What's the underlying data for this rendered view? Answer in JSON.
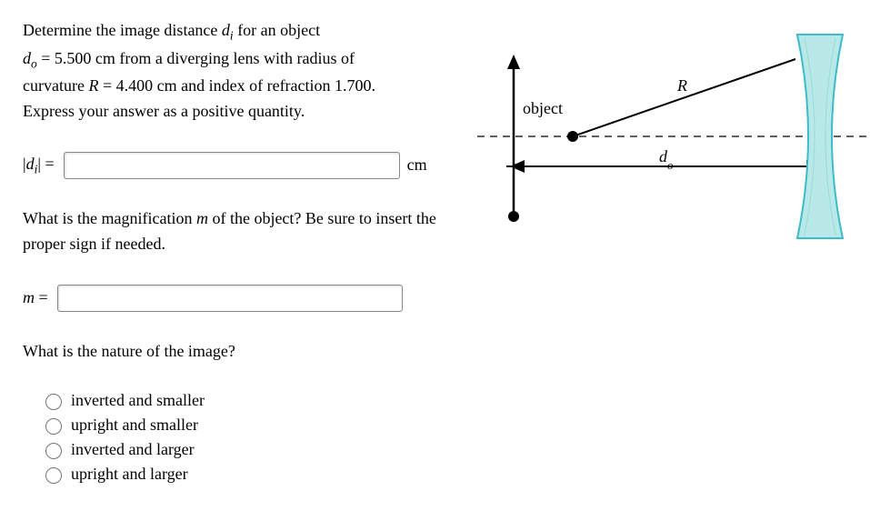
{
  "q1": {
    "prompt_parts": {
      "l1a": "Determine the image distance ",
      "l1b": "d",
      "l1c": "i",
      "l1d": " for an object",
      "l2a": "d",
      "l2b": "o",
      "l2c": " = 5.500 cm from a diverging lens with radius of",
      "l3a": "curvature ",
      "l3b": "R",
      "l3c": " = 4.400 cm and index of refraction 1.700.",
      "l4": "Express your answer as a positive quantity."
    },
    "label_a": "|",
    "label_b": "d",
    "label_c": "i",
    "label_d": "| =",
    "value": "",
    "unit": "cm"
  },
  "q2": {
    "prompt_a": "What is the magnification ",
    "prompt_b": "m",
    "prompt_c": " of the object? Be sure to insert the proper sign if needed.",
    "label_a": "m",
    "label_b": " =",
    "value": ""
  },
  "q3": {
    "prompt": "What is the nature of the image?",
    "options": [
      "inverted and smaller",
      "upright and smaller",
      "inverted and larger",
      "upright and larger"
    ]
  },
  "diagram": {
    "object_label": "object",
    "R_label": "R",
    "do_label_a": "d",
    "do_label_b": "o"
  }
}
